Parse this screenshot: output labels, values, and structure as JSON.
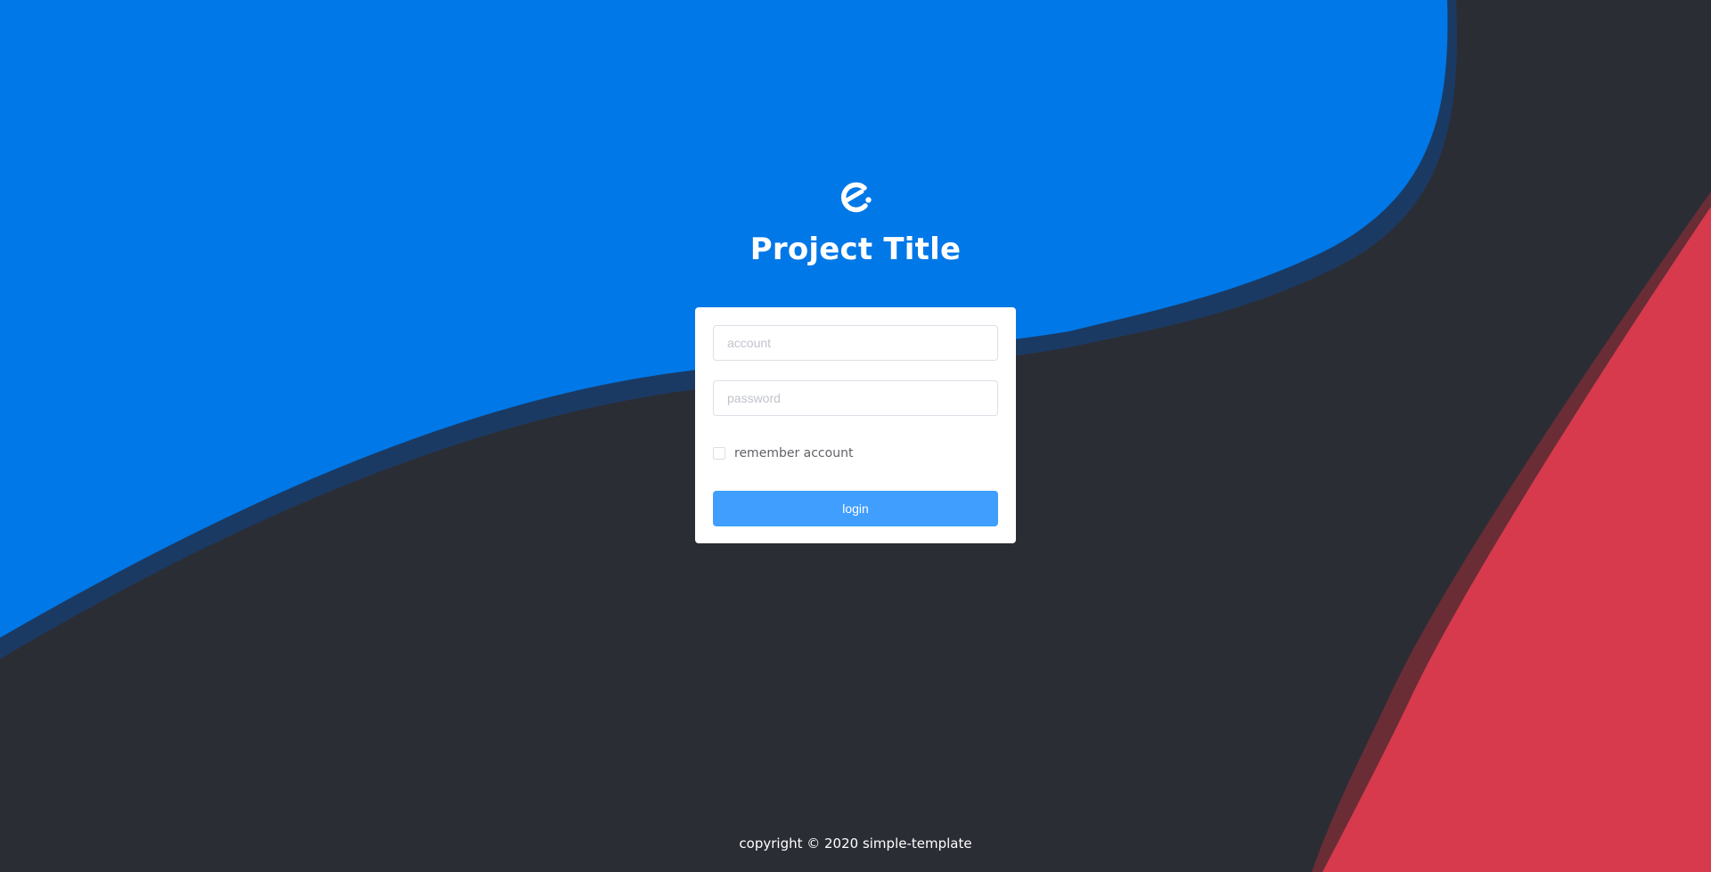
{
  "colors": {
    "background": "#2b2d35",
    "blue_shape": "#0078e7",
    "blue_shadow": "#1b3a63",
    "red_shape": "#d63a4c",
    "red_shadow": "#6a2d35",
    "primary_button": "#409eff"
  },
  "brand": {
    "logo_icon": "element-e-logo-icon",
    "title": "Project Title"
  },
  "login_form": {
    "account_placeholder": "account",
    "account_value": "",
    "password_placeholder": "password",
    "password_value": "",
    "remember_label": "remember account",
    "remember_checked": false,
    "login_label": "login"
  },
  "footer": {
    "copyright": "copyright © 2020 simple-template"
  }
}
